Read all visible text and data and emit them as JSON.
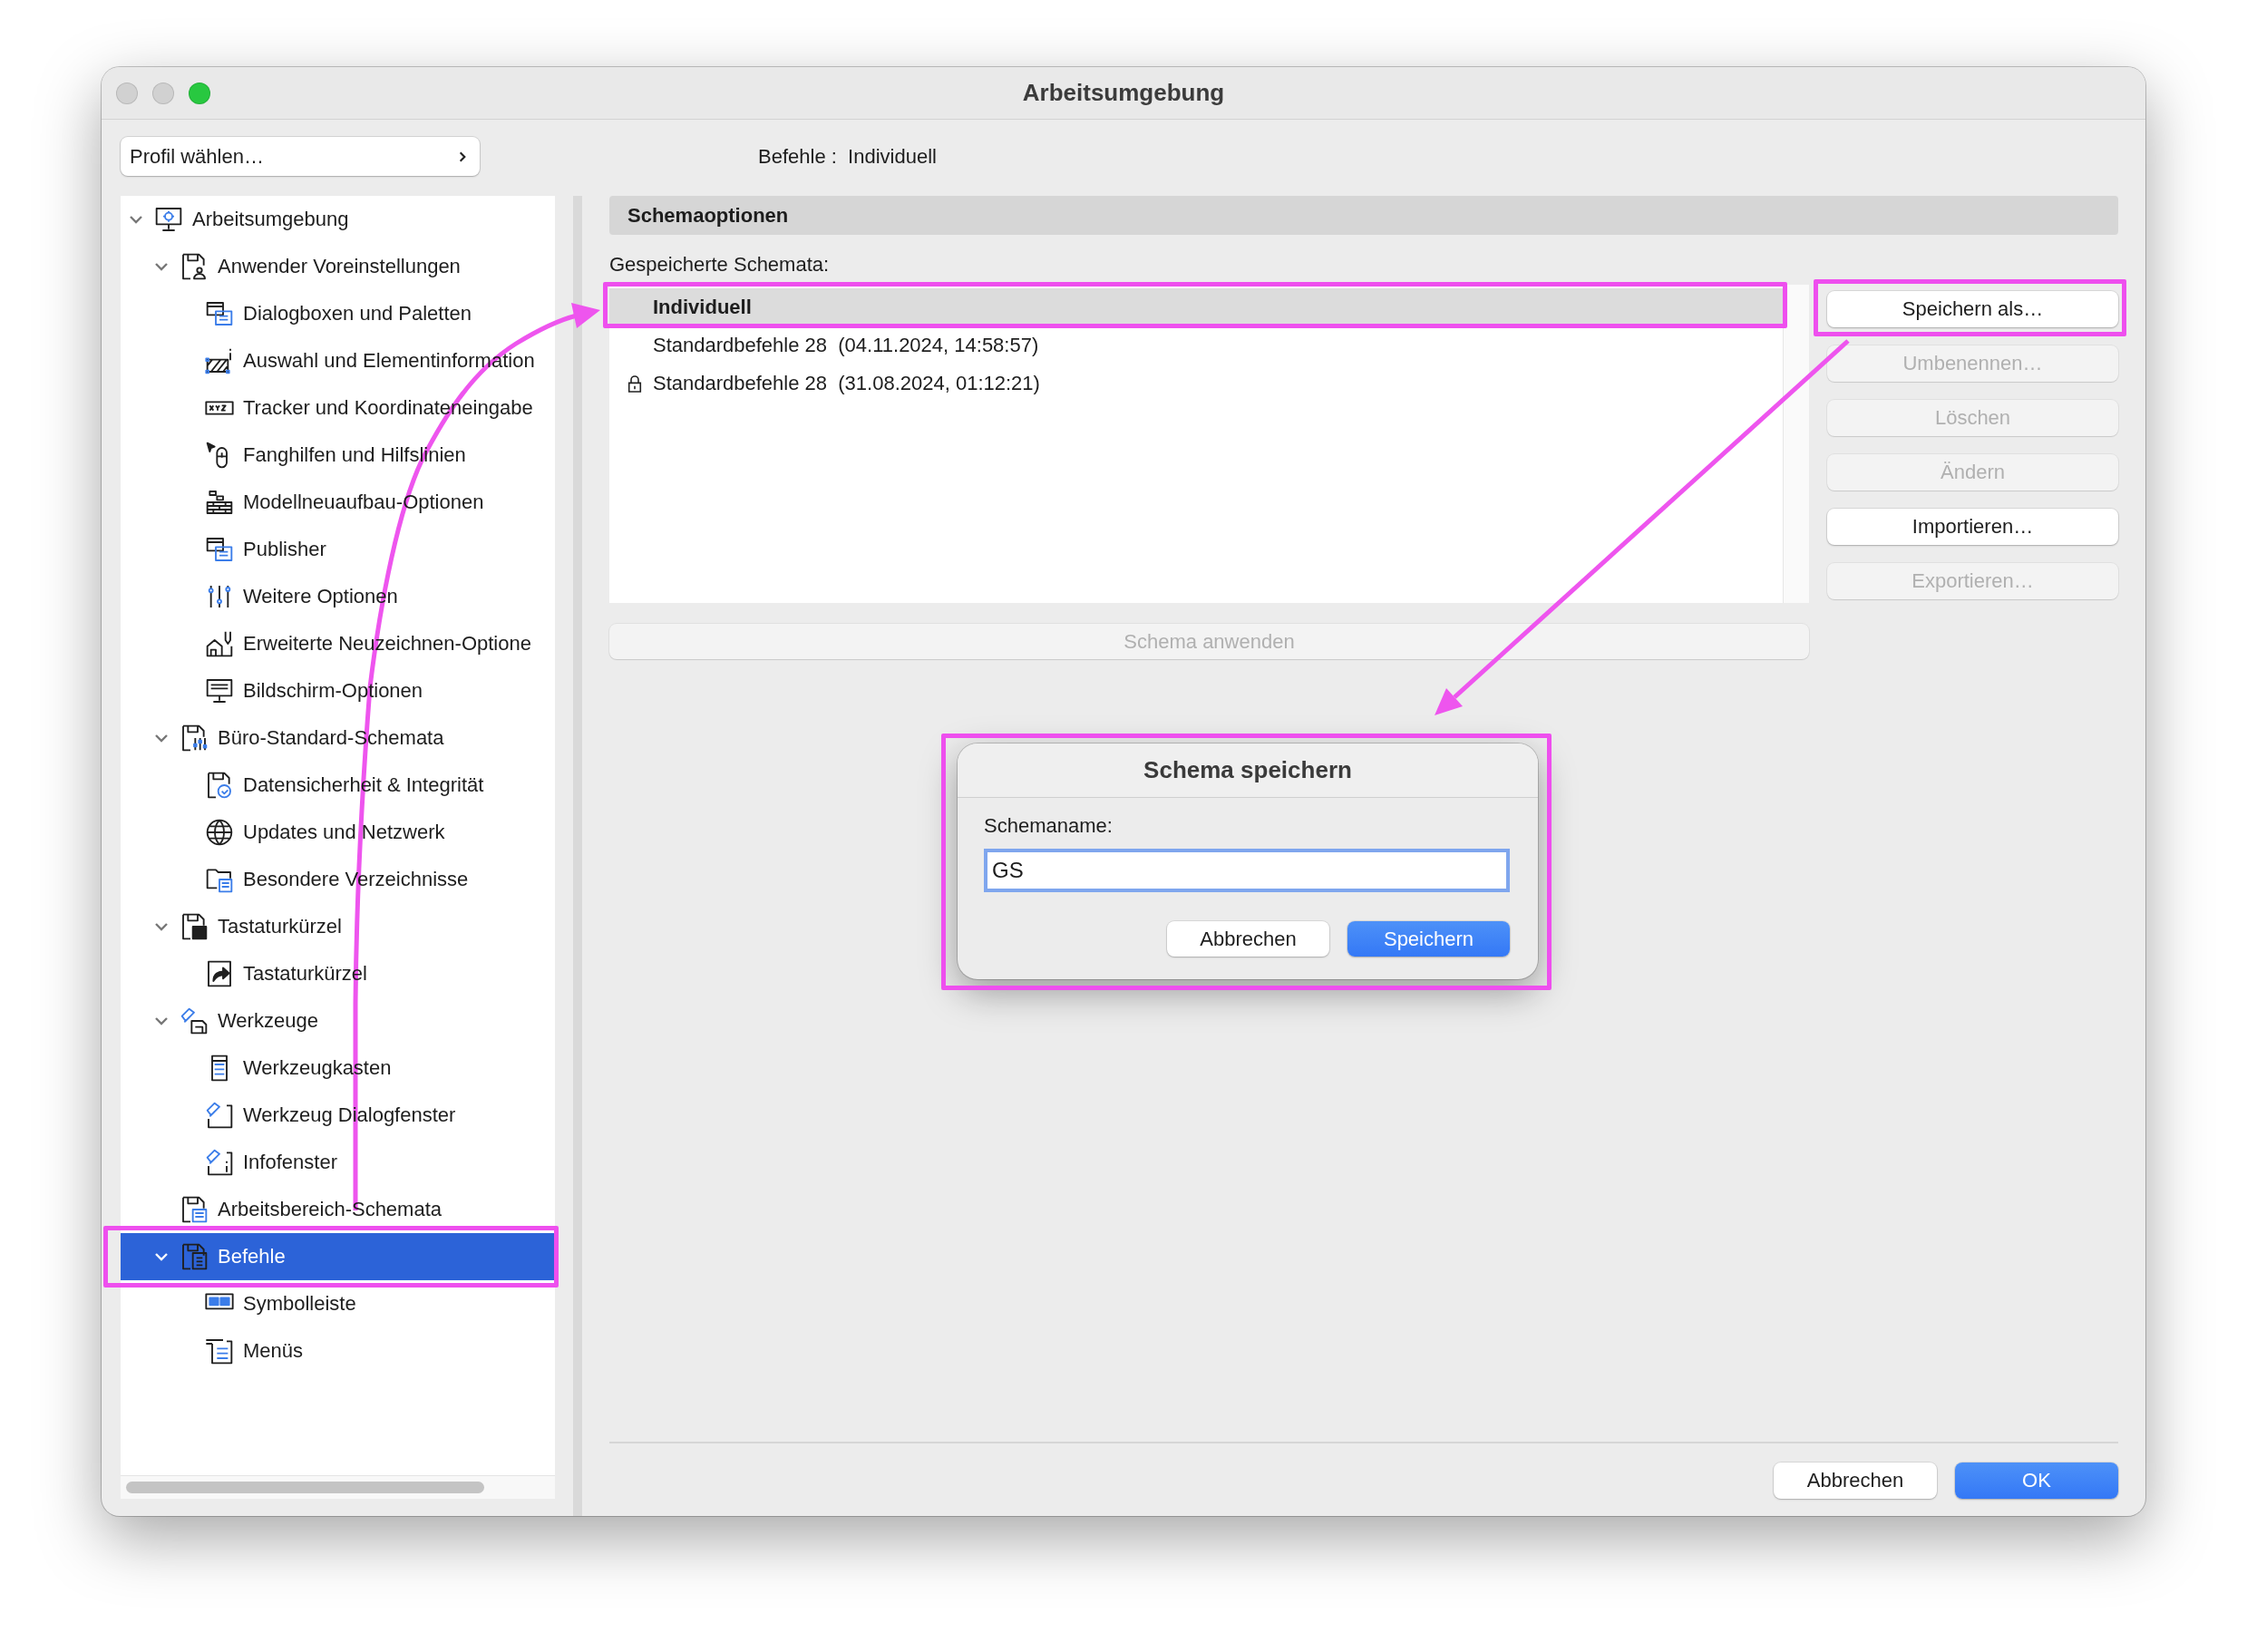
{
  "window": {
    "title": "Arbeitsumgebung",
    "controls": [
      {
        "kind": "close",
        "enabled": false
      },
      {
        "kind": "minimize",
        "enabled": false
      },
      {
        "kind": "zoom",
        "enabled": true
      }
    ]
  },
  "profile_button": {
    "label": "Profil wählen…"
  },
  "breadcrumb": "Befehle :  Individuell",
  "tree": [
    {
      "label": "Arbeitsumgebung",
      "expanded": true,
      "selected": false,
      "highlighted": false,
      "children": [
        {
          "label": "Anwender Voreinstellungen",
          "expanded": true,
          "selected": false,
          "highlighted": false,
          "children": [
            {
              "label": "Dialogboxen und Paletten",
              "selected": false,
              "highlighted": false
            },
            {
              "label": "Auswahl und Elementinformation",
              "selected": false,
              "highlighted": false
            },
            {
              "label": "Tracker und Koordinateneingabe",
              "selected": false,
              "highlighted": false
            },
            {
              "label": "Fanghilfen und Hilfslinien",
              "selected": false,
              "highlighted": false
            },
            {
              "label": "Modellneuaufbau-Optionen",
              "selected": false,
              "highlighted": false
            },
            {
              "label": "Publisher",
              "selected": false,
              "highlighted": false
            },
            {
              "label": "Weitere Optionen",
              "selected": false,
              "highlighted": false
            },
            {
              "label": "Erweiterte Neuzeichnen-Optione",
              "selected": false,
              "highlighted": false
            },
            {
              "label": "Bildschirm-Optionen",
              "selected": false,
              "highlighted": false
            }
          ]
        },
        {
          "label": "Büro-Standard-Schemata",
          "expanded": true,
          "selected": false,
          "highlighted": false,
          "children": [
            {
              "label": "Datensicherheit & Integrität",
              "selected": false,
              "highlighted": false
            },
            {
              "label": "Updates und Netzwerk",
              "selected": false,
              "highlighted": false
            },
            {
              "label": "Besondere Verzeichnisse",
              "selected": false,
              "highlighted": false
            }
          ]
        },
        {
          "label": "Tastaturkürzel",
          "expanded": true,
          "selected": false,
          "highlighted": false,
          "children": [
            {
              "label": "Tastaturkürzel",
              "selected": false,
              "highlighted": false
            }
          ]
        },
        {
          "label": "Werkzeuge",
          "expanded": true,
          "selected": false,
          "highlighted": false,
          "children": [
            {
              "label": "Werkzeugkasten",
              "selected": false,
              "highlighted": false
            },
            {
              "label": "Werkzeug Dialogfenster",
              "selected": false,
              "highlighted": false
            },
            {
              "label": "Infofenster",
              "selected": false,
              "highlighted": false
            }
          ]
        },
        {
          "label": "Arbeitsbereich-Schemata",
          "selected": false,
          "highlighted": false
        },
        {
          "label": "Befehle",
          "expanded": true,
          "selected": true,
          "highlighted": true,
          "children": [
            {
              "label": "Symbolleiste",
              "selected": false,
              "highlighted": false
            },
            {
              "label": "Menüs",
              "selected": false,
              "highlighted": false
            }
          ]
        }
      ]
    }
  ],
  "schema_options": {
    "title": "Schemaoptionen",
    "list_label": "Gespeicherte Schemata:",
    "schemas": [
      {
        "name": "Individuell",
        "selected": true,
        "locked": false,
        "highlighted": true
      },
      {
        "name": "Standardbefehle 28  (04.11.2024, 14:58:57)",
        "selected": false,
        "locked": false,
        "highlighted": false
      },
      {
        "name": "Standardbefehle 28  (31.08.2024, 01:12:21)",
        "selected": false,
        "locked": true,
        "highlighted": false
      }
    ],
    "actions": [
      {
        "label": "Speichern als…",
        "disabled": false,
        "highlighted": true
      },
      {
        "label": "Umbenennen…",
        "disabled": true,
        "highlighted": false
      },
      {
        "label": "Löschen",
        "disabled": true,
        "highlighted": false
      },
      {
        "label": "Ändern",
        "disabled": true,
        "highlighted": false
      },
      {
        "label": "Importieren…",
        "disabled": false,
        "highlighted": false
      },
      {
        "label": "Exportieren…",
        "disabled": true,
        "highlighted": false
      }
    ],
    "apply_button": {
      "label": "Schema anwenden",
      "disabled": true
    }
  },
  "save_dialog": {
    "title": "Schema speichern",
    "field_label": "Schemaname:",
    "field_value": "GS",
    "focused": true,
    "highlighted": true,
    "buttons": [
      {
        "label": "Abbrechen",
        "default": false
      },
      {
        "label": "Speichern",
        "default": true
      }
    ]
  },
  "footer_buttons": [
    {
      "label": "Abbrechen",
      "default": false
    },
    {
      "label": "OK",
      "default": true
    }
  ]
}
